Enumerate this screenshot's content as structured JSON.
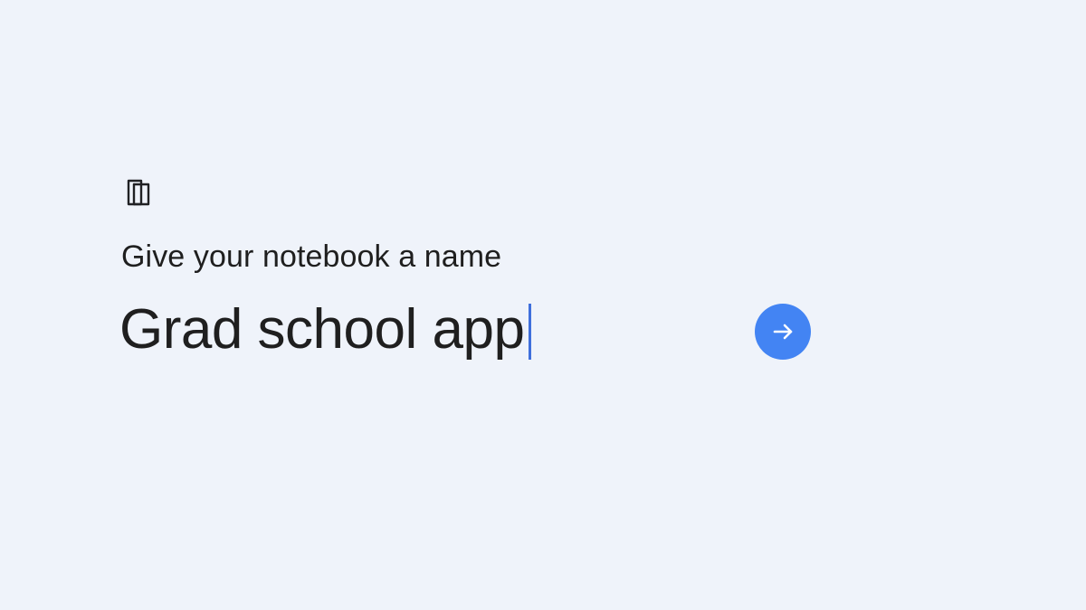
{
  "header": {
    "icon": "notebook-icon"
  },
  "form": {
    "prompt_label": "Give your notebook a name",
    "name_value": "Grad school app",
    "submit_icon": "arrow-right-icon"
  },
  "colors": {
    "background": "#eff3fa",
    "text": "#1f1f1f",
    "cursor": "#3f6fdc",
    "accent": "#4384f3"
  }
}
